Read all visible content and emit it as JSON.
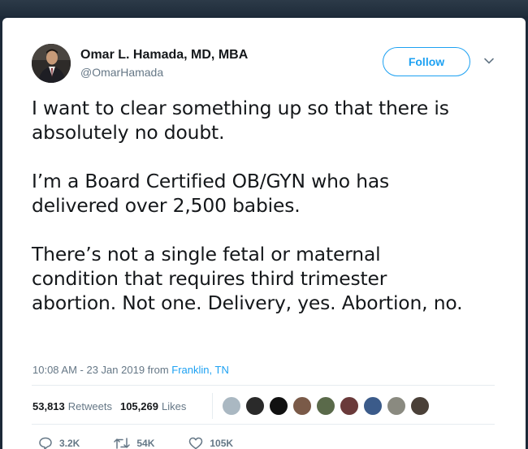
{
  "author": {
    "name": "Omar L. Hamada, MD, MBA",
    "handle": "@OmarHamada"
  },
  "follow_label": "Follow",
  "tweet": {
    "paragraphs": [
      "I want to clear something up so that there is\nabsolutely no doubt.",
      "I’m a Board Certified OB/GYN who has\ndelivered over 2,500 babies.",
      "There’s not a single fetal or maternal\ncondition that requires third trimester\nabortion. Not one. Delivery, yes. Abortion, no."
    ]
  },
  "meta": {
    "timestamp": "10:08 AM - 23 Jan 2019 from ",
    "location": "Franklin, TN"
  },
  "stats": {
    "retweets_count": "53,813",
    "retweets_label": "Retweets",
    "likes_count": "105,269",
    "likes_label": "Likes"
  },
  "actions": {
    "replies": "3.2K",
    "retweets": "54K",
    "likes": "105K"
  },
  "colors": {
    "accent": "#1da1f2",
    "text": "#14171a",
    "muted": "#657786",
    "frame": "#1c2938"
  }
}
